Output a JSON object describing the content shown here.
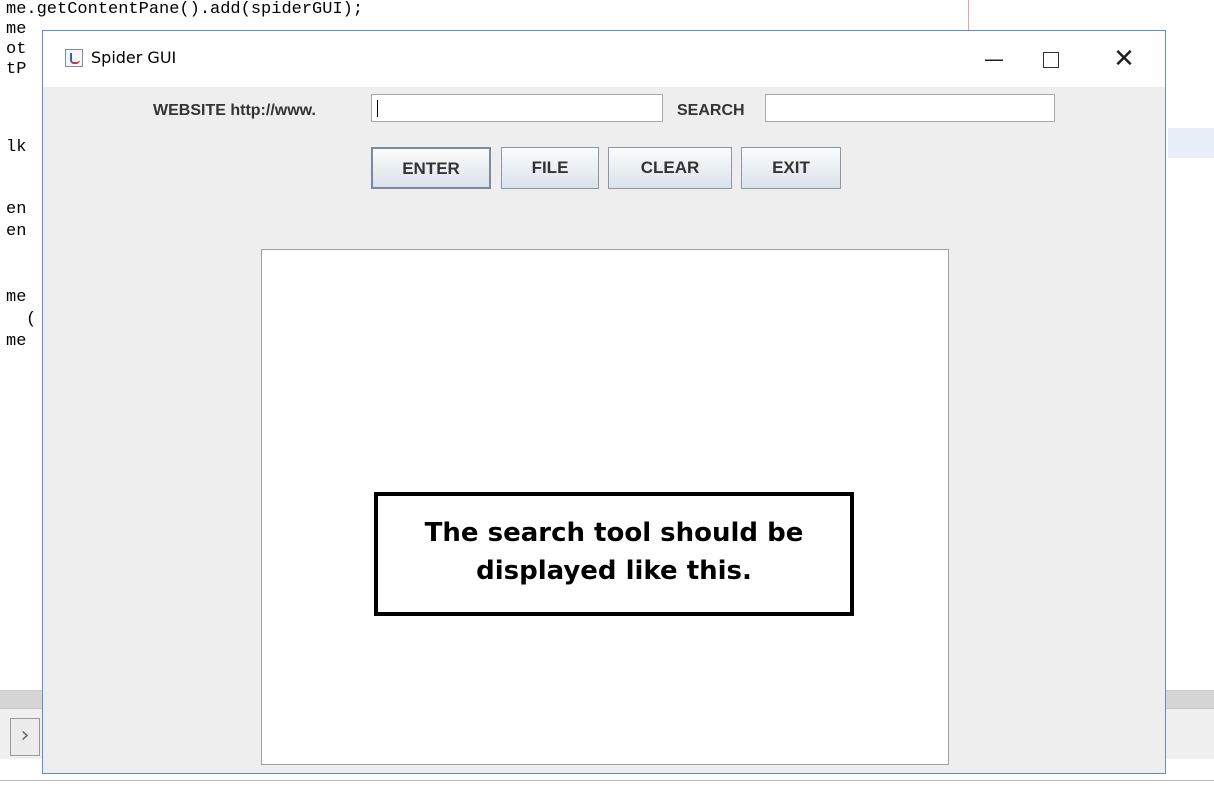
{
  "background_code": {
    "lines": [
      "me.getContentPane().add(spiderGUI);",
      "me",
      "ot",
      "tP",
      "lk",
      "en",
      "en",
      "me",
      "(",
      "me"
    ]
  },
  "window": {
    "title": "Spider GUI",
    "controls": {
      "minimize": "—",
      "maximize": "□",
      "close": "✕"
    }
  },
  "form": {
    "website_label": "WEBSITE http://www.",
    "website_value": "",
    "search_label": "SEARCH",
    "search_value": ""
  },
  "buttons": {
    "enter": "ENTER",
    "file": "FILE",
    "clear": "CLEAR",
    "exit": "EXIT"
  },
  "callout": {
    "line1": "The search tool should be",
    "line2": "displayed like this."
  },
  "colors": {
    "window_border": "#5a8fd4",
    "window_bg": "#eeeeee",
    "button_border": "#8b96a6"
  },
  "icons": {
    "app": "java-cup-icon",
    "expand": "chevron-right-icon"
  }
}
